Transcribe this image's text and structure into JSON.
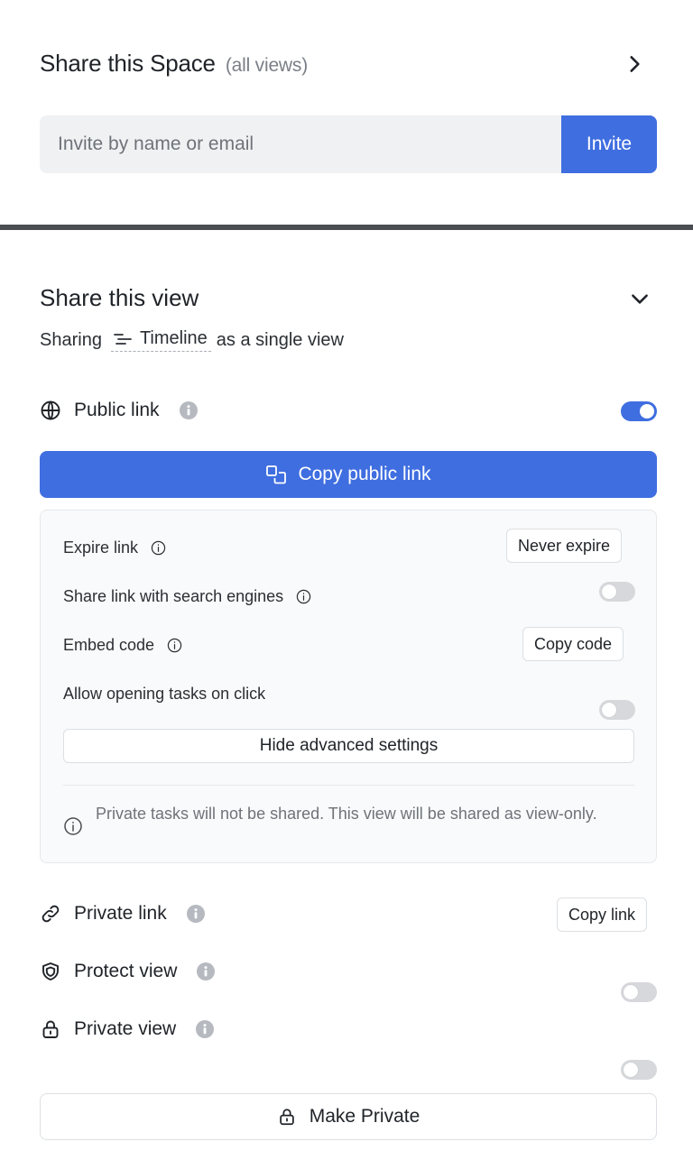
{
  "share_space": {
    "title": "Share this Space",
    "subtitle": "(all views)",
    "invite_placeholder": "Invite by name or email",
    "invite_button": "Invite"
  },
  "share_view": {
    "title": "Share this view",
    "sharing_prefix": "Sharing",
    "view_name": "Timeline",
    "sharing_suffix": "as a single view",
    "public_link": {
      "label": "Public link",
      "enabled": true,
      "copy_button": "Copy public link"
    },
    "advanced": {
      "expire_label": "Expire link",
      "expire_button": "Never expire",
      "search_engines_label": "Share link with search engines",
      "search_engines_enabled": false,
      "embed_label": "Embed code",
      "embed_button": "Copy code",
      "open_tasks_label": "Allow opening tasks on click",
      "open_tasks_enabled": false,
      "hide_button": "Hide advanced settings",
      "note": "Private tasks will not be shared. This view will be shared as view-only."
    },
    "private_link": {
      "label": "Private link",
      "copy_button": "Copy link"
    },
    "protect_view": {
      "label": "Protect view",
      "enabled": false
    },
    "private_view": {
      "label": "Private view",
      "enabled": false
    },
    "make_private_button": "Make Private"
  },
  "colors": {
    "accent": "#3f6ee0",
    "divider": "#4a4d52"
  }
}
